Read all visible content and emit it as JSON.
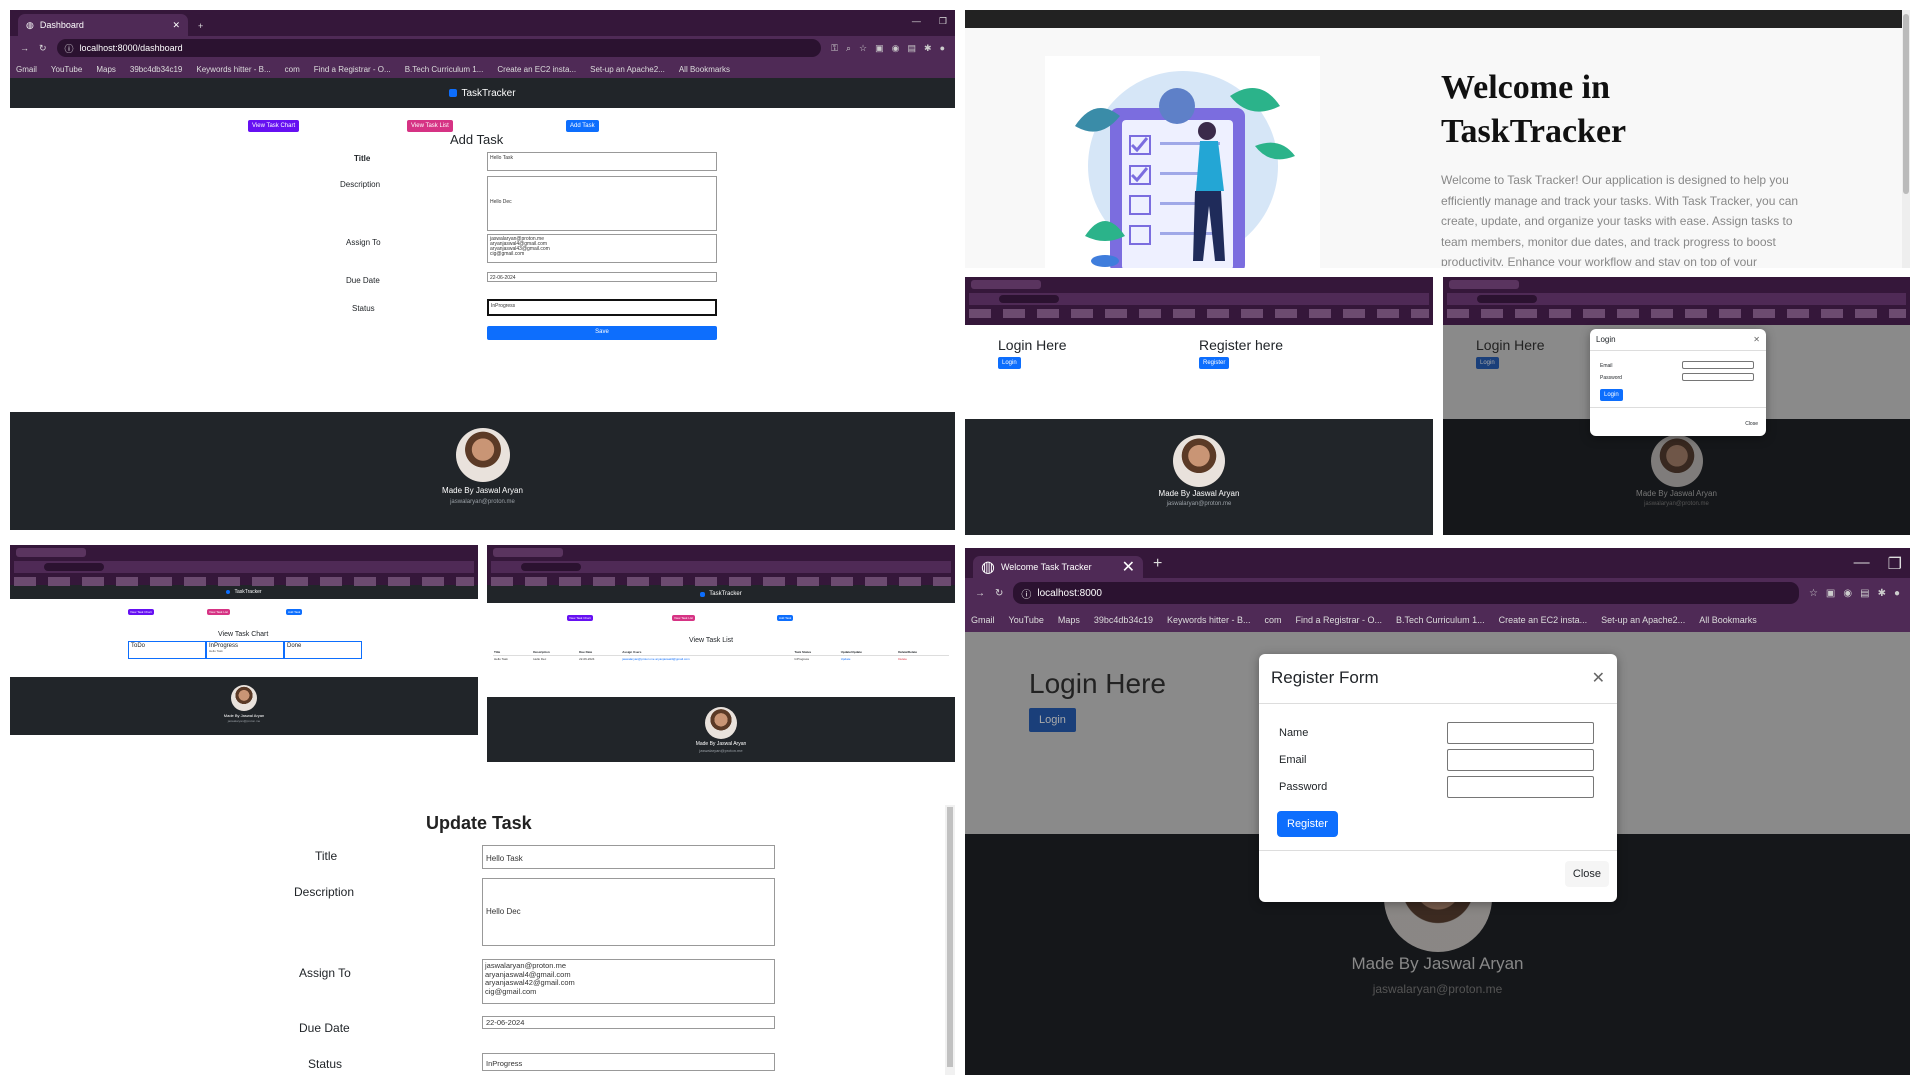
{
  "dashboard": {
    "tab_title": "Dashboard",
    "url": "localhost:8000/dashboard",
    "bookmarks": [
      "Gmail",
      "YouTube",
      "Maps",
      "39bc4db34c19",
      "Keywords hitter - B...",
      "com",
      "Find a Registrar - O...",
      "B.Tech Curriculum 1...",
      "Create an EC2 insta...",
      "Set-up an Apache2...",
      "All Bookmarks"
    ],
    "brand": "TaskTracker",
    "btn_chart": "View Task Chart",
    "btn_list": "View Task List",
    "btn_add": "Add Task",
    "form_title": "Add Task",
    "label_title": "Title",
    "label_description": "Description",
    "label_assign": "Assign To",
    "label_due": "Due Date",
    "label_status": "Status",
    "value_title": "Hello Task",
    "value_description": "Hello Dec",
    "assign_options": [
      "jaswalaryan@proton.me",
      "aryanjaswal4@gmail.com",
      "aryanjaswal43@gmail.com",
      "cig@gmail.com"
    ],
    "value_due": "22-06-2024",
    "value_status": "InProgress",
    "btn_save": "Save",
    "footer_name": "Made By Jaswal Aryan",
    "footer_email": "jaswalaryan@proton.me"
  },
  "welcome": {
    "heading": "Welcome in TaskTracker",
    "paragraph": "Welcome to Task Tracker! Our application is designed to help you efficiently manage and track your tasks. With Task Tracker, you can create, update, and organize your tasks with ease. Assign tasks to team members, monitor due dates, and track progress to boost productivity. Enhance your workflow and stay on top of your"
  },
  "home": {
    "login_heading": "Login Here",
    "login_btn": "Login",
    "register_heading": "Register here",
    "register_btn": "Register",
    "footer_name": "Made By Jaswal Aryan",
    "footer_email": "jaswalaryan@proton.me"
  },
  "login_modal": {
    "title": "Login",
    "email": "Email",
    "password": "Password",
    "submit": "Login",
    "close": "Close"
  },
  "chart_view": {
    "heading": "View Task Chart",
    "columns": [
      "ToDo",
      "InProgress",
      "Done"
    ],
    "inprogress_item": "Hello Task"
  },
  "list_view": {
    "heading": "View Task List",
    "headers": [
      "Title",
      "Description",
      "Due Date",
      "Assign Users",
      "Task Status",
      "Update/Update",
      "Delete/Delete"
    ],
    "row": [
      "Hello Task",
      "Hello Dec",
      "22-06-2024",
      "jaswalaryan@proton.me aryanjaswal4@gmail.com",
      "InProgress",
      "Update",
      "Delete"
    ]
  },
  "update_task": {
    "title": "Update Task",
    "label_title": "Title",
    "label_description": "Description",
    "label_assign": "Assign To",
    "label_due": "Due Date",
    "label_status": "Status",
    "value_title": "Hello Task",
    "value_description": "Hello Dec",
    "assign_options": [
      "jaswalaryan@proton.me",
      "aryanjaswal4@gmail.com",
      "aryanjaswal42@gmail.com",
      "cig@gmail.com"
    ],
    "value_due": "22-06-2024",
    "value_status": "InProgress"
  },
  "register_screen": {
    "tab_title": "Welcome Task Tracker",
    "url": "localhost:8000",
    "bookmarks": [
      "Gmail",
      "YouTube",
      "Maps",
      "39bc4db34c19",
      "Keywords hitter - B...",
      "com",
      "Find a Registrar - O...",
      "B.Tech Curriculum 1...",
      "Create an EC2 insta...",
      "Set-up an Apache2...",
      "All Bookmarks"
    ],
    "login_heading": "Login Here",
    "login_btn": "Login",
    "modal_title": "Register Form",
    "name": "Name",
    "email": "Email",
    "password": "Password",
    "register": "Register",
    "close": "Close",
    "footer_name": "Made By Jaswal Aryan",
    "footer_email": "jaswalaryan@proton.me"
  }
}
